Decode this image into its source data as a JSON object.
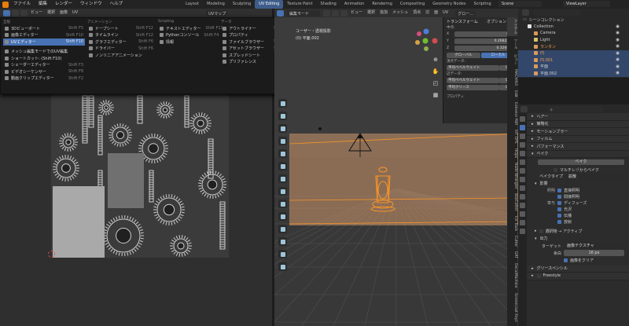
{
  "topbar": {
    "menus": [
      "ファイル",
      "編集",
      "レンダー",
      "ウィンドウ",
      "ヘルプ"
    ],
    "workspaces": [
      "Layout",
      "Modeling",
      "Sculpting",
      "UV Editing",
      "Texture Paint",
      "Shading",
      "Animation",
      "Rendering",
      "Compositing",
      "Geometry Nodes",
      "Scripting"
    ],
    "active_workspace": "UV Editing",
    "scene": "Scene",
    "view_layer": "ViewLayer"
  },
  "uv_header": {
    "items": [
      "ビュー",
      "選択",
      "画像",
      "UV"
    ],
    "uv_map": "UVマップ"
  },
  "viewport_header": {
    "mode": "編集モード",
    "items": [
      "ビュー",
      "選択",
      "追加",
      "メッシュ",
      "頂点",
      "辺",
      "面",
      "UV"
    ],
    "transform_orientation": "グロー…",
    "options": "オプション"
  },
  "editor_menu": {
    "columns": [
      {
        "heading": "全般",
        "items": [
          {
            "label": "3Dビューポート",
            "shortcut": "Shift F5",
            "selected": false
          },
          {
            "label": "画像エディター",
            "shortcut": "Shift F10",
            "selected": false
          },
          {
            "label": "UVエディター",
            "shortcut": "Shift F10",
            "selected": true
          },
          {
            "label": "",
            "shortcut": "",
            "selected": false
          },
          {
            "label": "メッシュ編集モードでのUV編集",
            "shortcut": "",
            "selected": false
          },
          {
            "label": "ショートカット: (Shift F10)",
            "shortcut": "",
            "selected": false
          },
          {
            "label": "シェーダーエディター",
            "shortcut": "Shift F3",
            "selected": false
          },
          {
            "label": "ビデオシーケンサー",
            "shortcut": "Shift F8",
            "selected": false
          },
          {
            "label": "動画クリップエディター",
            "shortcut": "Shift F2",
            "selected": false
          }
        ]
      },
      {
        "heading": "アニメーション",
        "items": [
          {
            "label": "ドープシート",
            "shortcut": "Shift F12",
            "selected": false
          },
          {
            "label": "タイムライン",
            "shortcut": "Shift F12",
            "selected": false
          },
          {
            "label": "グラフエディター",
            "shortcut": "Shift F6",
            "selected": false
          },
          {
            "label": "ドライバー",
            "shortcut": "Shift F6",
            "selected": false
          },
          {
            "label": "ノンリニアアニメーション",
            "shortcut": "",
            "selected": false
          }
        ]
      },
      {
        "heading": "Scripting",
        "items": [
          {
            "label": "テキストエディター",
            "shortcut": "Shift F11",
            "selected": false
          },
          {
            "label": "Pythonコンソール",
            "shortcut": "Shift F4",
            "selected": false
          },
          {
            "label": "情報",
            "shortcut": "",
            "selected": false
          }
        ]
      },
      {
        "heading": "データ",
        "items": [
          {
            "label": "アウトライナー",
            "shortcut": "Shift F9",
            "selected": false
          },
          {
            "label": "プロパティ",
            "shortcut": "",
            "selected": false
          },
          {
            "label": "ファイルブラウザー",
            "shortcut": "Shift F1",
            "selected": false
          },
          {
            "label": "アセットブラウザー",
            "shortcut": "Shift F1",
            "selected": false
          },
          {
            "label": "スプレッドシート",
            "shortcut": "",
            "selected": false
          },
          {
            "label": "プリファレンス",
            "shortcut": "",
            "selected": false
          }
        ]
      }
    ]
  },
  "viewport": {
    "view_name": "ユーザー・透視投影",
    "object_name": "(0) 平面.002"
  },
  "n_panel": {
    "title": "トランスフォーム",
    "median_label": "中点:",
    "x": "0 m",
    "y": "0.26823 m",
    "z": "0.3268 m",
    "global": "グローバル",
    "local": "ローカル",
    "vertex_data": "頂点データ:",
    "vertex_bevel": "平均ベベルウェイト",
    "vertex_bevel_val": "0.00",
    "edge_data": "辺データ:",
    "edge_bevel": "平均ベベルウェイト",
    "edge_bevel_val": "0.00",
    "edge_crease": "平均クリース",
    "edge_crease_val": "0.00",
    "properties": "プロパティ"
  },
  "side_tabs": [
    "アイテム",
    "ツール",
    "ビュー",
    "MACHIN3",
    "Edit",
    "Extreme PBR",
    "KIT OPS",
    "HOps",
    "Node Wrangler",
    "BoxCutter",
    "Ice Tools",
    "Cutter",
    "GRT",
    "DecalMachine",
    "Screencast Keys"
  ],
  "outliner": {
    "root": "シーンコレクション",
    "rows": [
      {
        "label": "Collection",
        "indent": 1,
        "selected": false
      },
      {
        "label": "Camera",
        "indent": 2,
        "selected": false
      },
      {
        "label": "Light",
        "indent": 2,
        "selected": false
      },
      {
        "label": "ランタン",
        "indent": 2,
        "selected": false
      },
      {
        "label": "円",
        "indent": 2,
        "selected": true
      },
      {
        "label": "円.001",
        "indent": 2,
        "selected": true
      },
      {
        "label": "平面",
        "indent": 2,
        "selected": true
      },
      {
        "label": "平面.002",
        "indent": 2,
        "selected": true
      }
    ]
  },
  "properties": {
    "search_placeholder": "",
    "sections": [
      "ヘアー",
      "簡略化",
      "モーションブラー",
      "フィルム",
      "パフォーマンス"
    ],
    "bake_section": "ベイク",
    "bake_button": "ベイク",
    "multires_label": "マルチレゾからベイク",
    "bake_type_label": "ベイクタイプ",
    "bake_type_value": "拡散",
    "influence": "影響",
    "lighting_label": "照明",
    "direct": "直接照明",
    "indirect": "間接照明",
    "contrib_label": "寄与",
    "diffuse": "ディフューズ",
    "gloss": "光沢",
    "transmission": "伝播",
    "emission": "放射",
    "selected_to_active": "選択物 → アクティブ",
    "output": "出力",
    "target_label": "ターゲット",
    "target_value": "画像テクスチャ",
    "margin_label": "余白",
    "margin_value": "16 px",
    "clear_image": "画像をクリア",
    "grease_pencil": "グリースペンシル",
    "freestyle": "Freestyle"
  },
  "colors": {
    "accent": "#4772b3",
    "selection_orange": "#f5932b",
    "plane_tint": "#ce976c"
  }
}
